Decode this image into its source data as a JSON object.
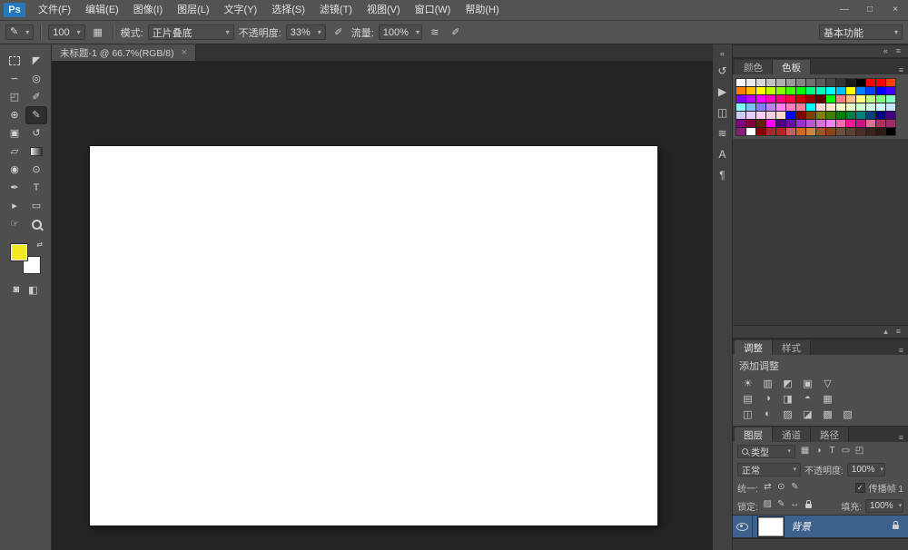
{
  "ui": {
    "panel_menu_icon": "≡"
  },
  "app": {
    "logo": "Ps",
    "menus": [
      "文件(F)",
      "编辑(E)",
      "图像(I)",
      "图层(L)",
      "文字(Y)",
      "选择(S)",
      "滤镜(T)",
      "视图(V)",
      "窗口(W)",
      "帮助(H)"
    ],
    "window_controls": [
      {
        "name": "minimize-button",
        "glyph": "—"
      },
      {
        "name": "restore-button",
        "glyph": "□"
      },
      {
        "name": "close-button",
        "glyph": "×"
      }
    ]
  },
  "options_bar": {
    "tool_icon": "✎",
    "brush_size": "100",
    "icon_toggle_panel": "▦",
    "mode_label": "模式:",
    "mode_value": "正片叠底",
    "opacity_label": "不透明度:",
    "opacity_value": "33%",
    "icon_pressure_opacity": "✐",
    "flow_label": "流量:",
    "flow_value": "100%",
    "icon_airbrush": "≋",
    "icon_pressure_size": "✐",
    "workspace": "基本功能"
  },
  "document_tab": {
    "title": "未标题-1 @ 66.7%(RGB/8)",
    "close": "×"
  },
  "toolbar": {
    "swap_icon": "⇄",
    "quickmask_icon": "◙",
    "screenmode_icon": "◧",
    "foreground_color": "#f2e921",
    "background_color": "#ffffff",
    "tools": [
      {
        "name": "rect-marquee",
        "glyph": "__marquee"
      },
      {
        "name": "move",
        "glyph": "◤"
      },
      {
        "name": "lasso",
        "glyph": "∽"
      },
      {
        "name": "quick-selection",
        "glyph": "◎"
      },
      {
        "name": "crop",
        "glyph": "◰"
      },
      {
        "name": "eyedropper",
        "glyph": "✐"
      },
      {
        "name": "spot-healing",
        "glyph": "⊕"
      },
      {
        "name": "brush",
        "glyph": "✎",
        "selected": true
      },
      {
        "name": "clone-stamp",
        "glyph": "▣"
      },
      {
        "name": "history-brush",
        "glyph": "↺"
      },
      {
        "name": "eraser",
        "glyph": "▱"
      },
      {
        "name": "gradient",
        "glyph": "__gradient"
      },
      {
        "name": "blur",
        "glyph": "◉"
      },
      {
        "name": "dodge",
        "glyph": "⊙"
      },
      {
        "name": "pen",
        "glyph": "✒"
      },
      {
        "name": "type",
        "glyph": "T"
      },
      {
        "name": "path-selection",
        "glyph": "▸"
      },
      {
        "name": "rectangle-shape",
        "glyph": "▭"
      },
      {
        "name": "hand",
        "glyph": "☞"
      },
      {
        "name": "zoom",
        "glyph": "__zoom"
      }
    ]
  },
  "dock": {
    "expand_icon": "«",
    "icons": [
      {
        "name": "history-panel-icon",
        "glyph": "↺"
      },
      {
        "name": "actions-panel-icon",
        "glyph": "▶"
      },
      {
        "name": "properties-panel-icon",
        "glyph": "◫"
      },
      {
        "name": "clone-source-panel-icon",
        "glyph": "≋"
      },
      {
        "name": "character-panel-icon",
        "glyph": "A"
      },
      {
        "name": "paragraph-panel-icon",
        "glyph": "¶"
      }
    ]
  },
  "panels": {
    "header_icons": [
      {
        "name": "collapse-panels-icon",
        "glyph": "«"
      },
      {
        "name": "panel-dock-menu-icon",
        "glyph": "≡"
      }
    ],
    "mid_icons": [
      {
        "name": "collapse-group-icon",
        "glyph": "▴"
      },
      {
        "name": "group-menu-icon",
        "glyph": "≡"
      }
    ],
    "colors": {
      "tabs": [
        "颜色",
        "色板"
      ],
      "active_tab": "色板",
      "swatches": [
        "#ffffff",
        "#ebebeb",
        "#d7d7d7",
        "#c2c2c2",
        "#aeaeae",
        "#999999",
        "#858585",
        "#707070",
        "#5c5c5c",
        "#474747",
        "#333333",
        "#1a1a1a",
        "#000000",
        "#ff0000",
        "#ff0000",
        "#ff4000",
        "#ff8000",
        "#ffbf00",
        "#ffff00",
        "#bfff00",
        "#80ff00",
        "#40ff00",
        "#00ff00",
        "#00ff80",
        "#00ffbf",
        "#00ffff",
        "#00bfff",
        "#ffff00",
        "#0080ff",
        "#0040ff",
        "#0000ff",
        "#4000ff",
        "#8000ff",
        "#bf00ff",
        "#ff00ff",
        "#ff00bf",
        "#ff0080",
        "#ff0040",
        "#cc0000",
        "#990000",
        "#660000",
        "#00ff00",
        "#ff8080",
        "#ffbf80",
        "#ffff80",
        "#bfff80",
        "#80ff80",
        "#80ffbf",
        "#80ffff",
        "#80bfff",
        "#8080ff",
        "#bf80ff",
        "#ff80ff",
        "#ff80bf",
        "#ff8099",
        "#00ffff",
        "#ffd9d9",
        "#ffe6cc",
        "#ffffcc",
        "#e6ffcc",
        "#ccffcc",
        "#ccffe6",
        "#ccffff",
        "#cce6ff",
        "#ccccff",
        "#e6ccff",
        "#ffccff",
        "#ffcce6",
        "#ffd9cc",
        "#0000ff",
        "#800000",
        "#804000",
        "#808000",
        "#408000",
        "#008000",
        "#008040",
        "#008080",
        "#004080",
        "#000080",
        "#400080",
        "#800080",
        "#800040",
        "#662200",
        "#ff00ff",
        "#4b0082",
        "#6a0dad",
        "#9932cc",
        "#ba55d3",
        "#da70d6",
        "#ee82ee",
        "#ff69b4",
        "#ff1493",
        "#c71585",
        "#db7093",
        "#b03060",
        "#9f2b68",
        "#871f78",
        "#ffffff",
        "#8b0000",
        "#a52a2a",
        "#b22222",
        "#cd5c5c",
        "#d2691e",
        "#cd853f",
        "#a0522d",
        "#8b4513",
        "#6f4e37",
        "#5c4033",
        "#4a2c2a",
        "#3b241e",
        "#2a1a14",
        "#000000"
      ]
    },
    "adjustments": {
      "tabs": [
        "调整",
        "样式"
      ],
      "active_tab": "调整",
      "hint": "添加调整",
      "rows": [
        [
          {
            "name": "brightness-contrast",
            "glyph": "☀"
          },
          {
            "name": "levels",
            "glyph": "▥"
          },
          {
            "name": "curves",
            "glyph": "◩"
          },
          {
            "name": "exposure",
            "glyph": "▣"
          },
          {
            "name": "vibrance",
            "glyph": "▽"
          }
        ],
        [
          {
            "name": "hue-saturation",
            "glyph": "▤"
          },
          {
            "name": "color-balance",
            "glyph": "◑"
          },
          {
            "name": "black-white",
            "glyph": "◨"
          },
          {
            "name": "photo-filter",
            "glyph": "◓"
          },
          {
            "name": "channel-mixer",
            "glyph": "▦"
          }
        ],
        [
          {
            "name": "color-lookup",
            "glyph": "◫"
          },
          {
            "name": "invert",
            "glyph": "◐"
          },
          {
            "name": "posterize",
            "glyph": "▨"
          },
          {
            "name": "threshold",
            "glyph": "◪"
          },
          {
            "name": "gradient-map",
            "glyph": "▩"
          },
          {
            "name": "selective-color",
            "glyph": "▧"
          }
        ]
      ]
    },
    "layers": {
      "tabs": [
        "图层",
        "通道",
        "路径"
      ],
      "active_tab": "图层",
      "filter_label": "类型",
      "filter_icons": [
        {
          "name": "filter-pixel-layers",
          "glyph": "▦"
        },
        {
          "name": "filter-adjustment-layers",
          "glyph": "◑"
        },
        {
          "name": "filter-type-layers",
          "glyph": "T"
        },
        {
          "name": "filter-shape-layers",
          "glyph": "▭"
        },
        {
          "name": "filter-smart-objects",
          "glyph": "◰"
        }
      ],
      "blend_mode": "正常",
      "opacity_label": "不透明度:",
      "opacity_value": "100%",
      "unify_label": "统一:",
      "unify_icons": [
        {
          "name": "unify-position",
          "glyph": "⇄"
        },
        {
          "name": "unify-visibility",
          "glyph": "⊙"
        },
        {
          "name": "unify-style",
          "glyph": "✎"
        }
      ],
      "propagate_check": "✓",
      "propagate_label": "传播帧 1",
      "lock_label": "锁定:",
      "lock_icons": [
        {
          "name": "lock-transparent-pixels",
          "glyph": "▨"
        },
        {
          "name": "lock-image-pixels",
          "glyph": "✎"
        },
        {
          "name": "lock-position",
          "glyph": "↔"
        },
        {
          "name": "lock-all",
          "glyph": "__lock"
        }
      ],
      "fill_label": "填充:",
      "fill_value": "100%",
      "layer": {
        "name": "背景"
      }
    }
  }
}
